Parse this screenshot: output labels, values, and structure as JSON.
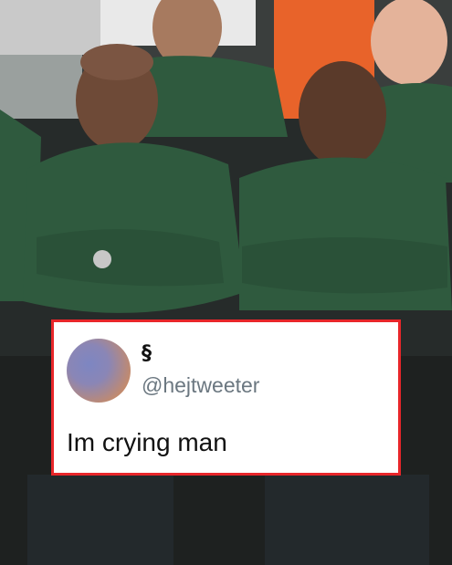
{
  "tweet": {
    "display_name": "§",
    "handle": "@hejtweeter",
    "text": "Im crying man"
  },
  "colors": {
    "card_border": "#e8262a",
    "jersey_green": "#2f5a3e",
    "handle_gray": "#6b7780"
  }
}
